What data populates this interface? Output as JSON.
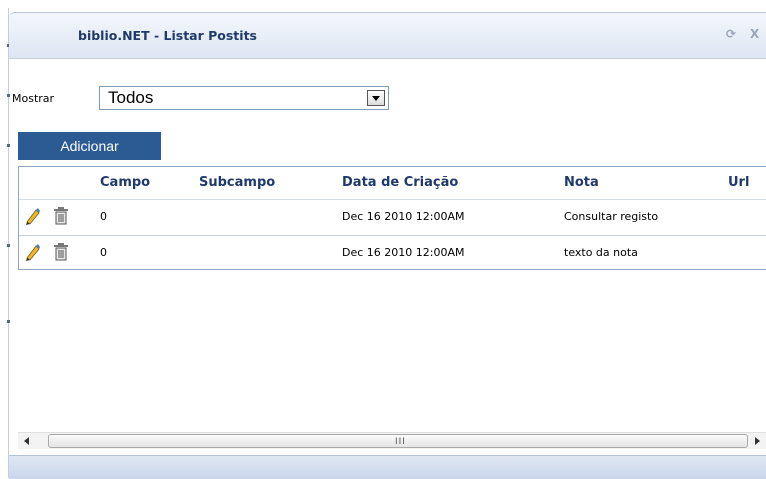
{
  "window": {
    "title": "biblio.NET - Listar Postits",
    "refresh_icon": "⟳",
    "close_icon": "X"
  },
  "filter": {
    "label": "Mostrar",
    "selected": "Todos"
  },
  "toolbar": {
    "add_label": "Adicionar"
  },
  "table": {
    "columns": [
      "Campo",
      "Subcampo",
      "Data de Criação",
      "Nota",
      "Url"
    ],
    "rows": [
      {
        "campo": "0",
        "subcampo": "",
        "data": "Dec 16 2010 12:00AM",
        "nota": "Consultar registo",
        "url": ""
      },
      {
        "campo": "0",
        "subcampo": "",
        "data": "Dec 16 2010 12:00AM",
        "nota": "texto da nota",
        "url": ""
      }
    ]
  },
  "scrollbar": {
    "grip": "III"
  },
  "colors": {
    "accent": "#2c5a93",
    "header_text": "#1f3a6b"
  }
}
